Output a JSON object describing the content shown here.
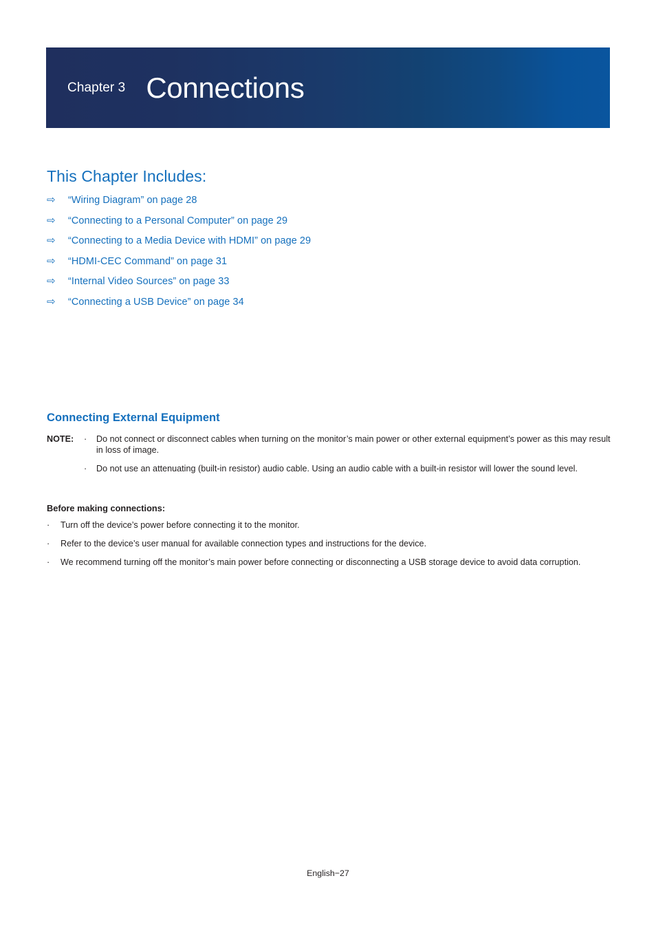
{
  "banner": {
    "chapter_label": "Chapter 3",
    "title": "Connections",
    "gradient_start": "#1f2f5e",
    "gradient_end": "#0a559e"
  },
  "includes": {
    "heading": "This Chapter Includes:",
    "arrow_icon": "⇨",
    "accent_color": "#1570bd",
    "items": [
      {
        "text": "“Wiring Diagram” on page 28"
      },
      {
        "text": "“Connecting to a Personal Computer” on page 29"
      },
      {
        "text": "“Connecting to a Media Device with HDMI” on page 29"
      },
      {
        "text": "“HDMI-CEC Command” on page 31"
      },
      {
        "text": "“Internal Video Sources” on page 33"
      },
      {
        "text": "“Connecting a USB Device” on page 34"
      }
    ]
  },
  "section": {
    "heading": "Connecting External Equipment",
    "note_label": "NOTE:",
    "bullet_glyph": "·",
    "notes": [
      {
        "text": "Do not connect or disconnect cables when turning on the monitor’s main power or other external equipment’s power as this may result in loss of image."
      },
      {
        "text": "Do not use an attenuating (built-in resistor) audio cable. Using an audio cable with a built-in resistor will lower the sound level."
      }
    ]
  },
  "before": {
    "heading": "Before making connections:",
    "bullet_glyph": "·",
    "items": [
      {
        "text": "Turn off the device’s power before connecting it to the monitor."
      },
      {
        "text": "Refer to the device’s user manual for available connection types and instructions for the device."
      },
      {
        "text": "We recommend turning off the monitor’s main power before connecting or disconnecting a USB storage device to avoid data corruption."
      }
    ]
  },
  "footer": {
    "text": "English−27"
  }
}
